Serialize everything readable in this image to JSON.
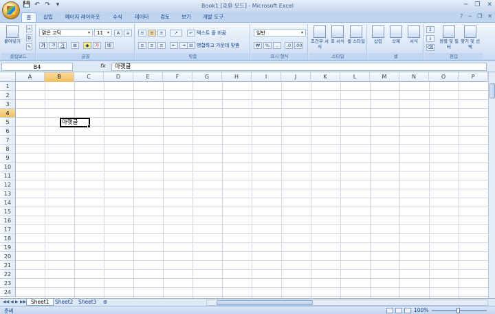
{
  "window": {
    "title": "Book1 [호환 모드] - Microsoft Excel"
  },
  "tabs": [
    "홈",
    "삽입",
    "페이지 레이아웃",
    "수식",
    "데이터",
    "검토",
    "보기",
    "개발 도구"
  ],
  "ribbon": {
    "paste": "붙여넣기",
    "font_name": "맑은 고딕",
    "font_size": "11",
    "wrap_text": "텍스트 줄 바꿈",
    "merge_center": "병합하고 가운데 맞춤",
    "number_format": "일반",
    "cond_format": "조건부 서식",
    "table_format": "표 서식",
    "cell_style": "셀 스타일",
    "insert": "삽입",
    "delete": "삭제",
    "format": "서식",
    "sort_filter": "정렬 및 필터",
    "find_select": "찾기 및 선택",
    "groups": [
      "클립보드",
      "글꼴",
      "맞춤",
      "표시 형식",
      "스타일",
      "셀",
      "편집"
    ]
  },
  "formula": {
    "name_box": "B4",
    "fx": "fx",
    "content": "아랫글"
  },
  "columns": [
    "A",
    "B",
    "C",
    "D",
    "E",
    "F",
    "G",
    "H",
    "I",
    "J",
    "K",
    "L",
    "M",
    "N",
    "O",
    "P"
  ],
  "rows": [
    "1",
    "2",
    "3",
    "4",
    "5",
    "6",
    "7",
    "8",
    "9",
    "10",
    "11",
    "12",
    "13",
    "14",
    "15",
    "16",
    "17",
    "18",
    "19",
    "20",
    "21",
    "22",
    "23",
    "24"
  ],
  "active_cell": {
    "ref": "B4",
    "value": "아랫글"
  },
  "sheets": [
    "Sheet1",
    "Sheet2",
    "Sheet3"
  ],
  "status": {
    "text": "준비",
    "zoom": "100%"
  }
}
